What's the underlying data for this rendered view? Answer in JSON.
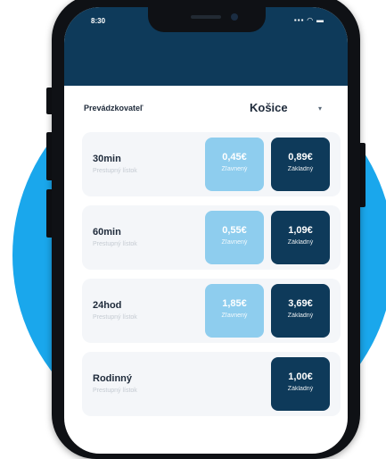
{
  "status_bar": {
    "time": "8:30",
    "icons": "▪▪▪ ◠ ▬"
  },
  "operator": {
    "label": "Prevádzkovateľ",
    "city": "Košice",
    "chevron": "▾"
  },
  "tickets": [
    {
      "title": "30min",
      "subtitle": "Prestupný lístok",
      "discounted": {
        "price": "0,45€",
        "label": "Zľavnený"
      },
      "base": {
        "price": "0,89€",
        "label": "Základný"
      }
    },
    {
      "title": "60min",
      "subtitle": "Prestupný lístok",
      "discounted": {
        "price": "0,55€",
        "label": "Zľavnený"
      },
      "base": {
        "price": "1,09€",
        "label": "Základný"
      }
    },
    {
      "title": "24hod",
      "subtitle": "Prestupný lístok",
      "discounted": {
        "price": "1,85€",
        "label": "Zľavnený"
      },
      "base": {
        "price": "3,69€",
        "label": "Základný"
      }
    },
    {
      "title": "Rodinný",
      "subtitle": "Prestupný lístok",
      "base": {
        "price": "1,00€",
        "label": "Základný"
      }
    }
  ],
  "colors": {
    "header": "#0e3a5a",
    "discount": "#8ecdee",
    "base": "#0e3a5a",
    "background_circle": "#1aa7ec"
  }
}
